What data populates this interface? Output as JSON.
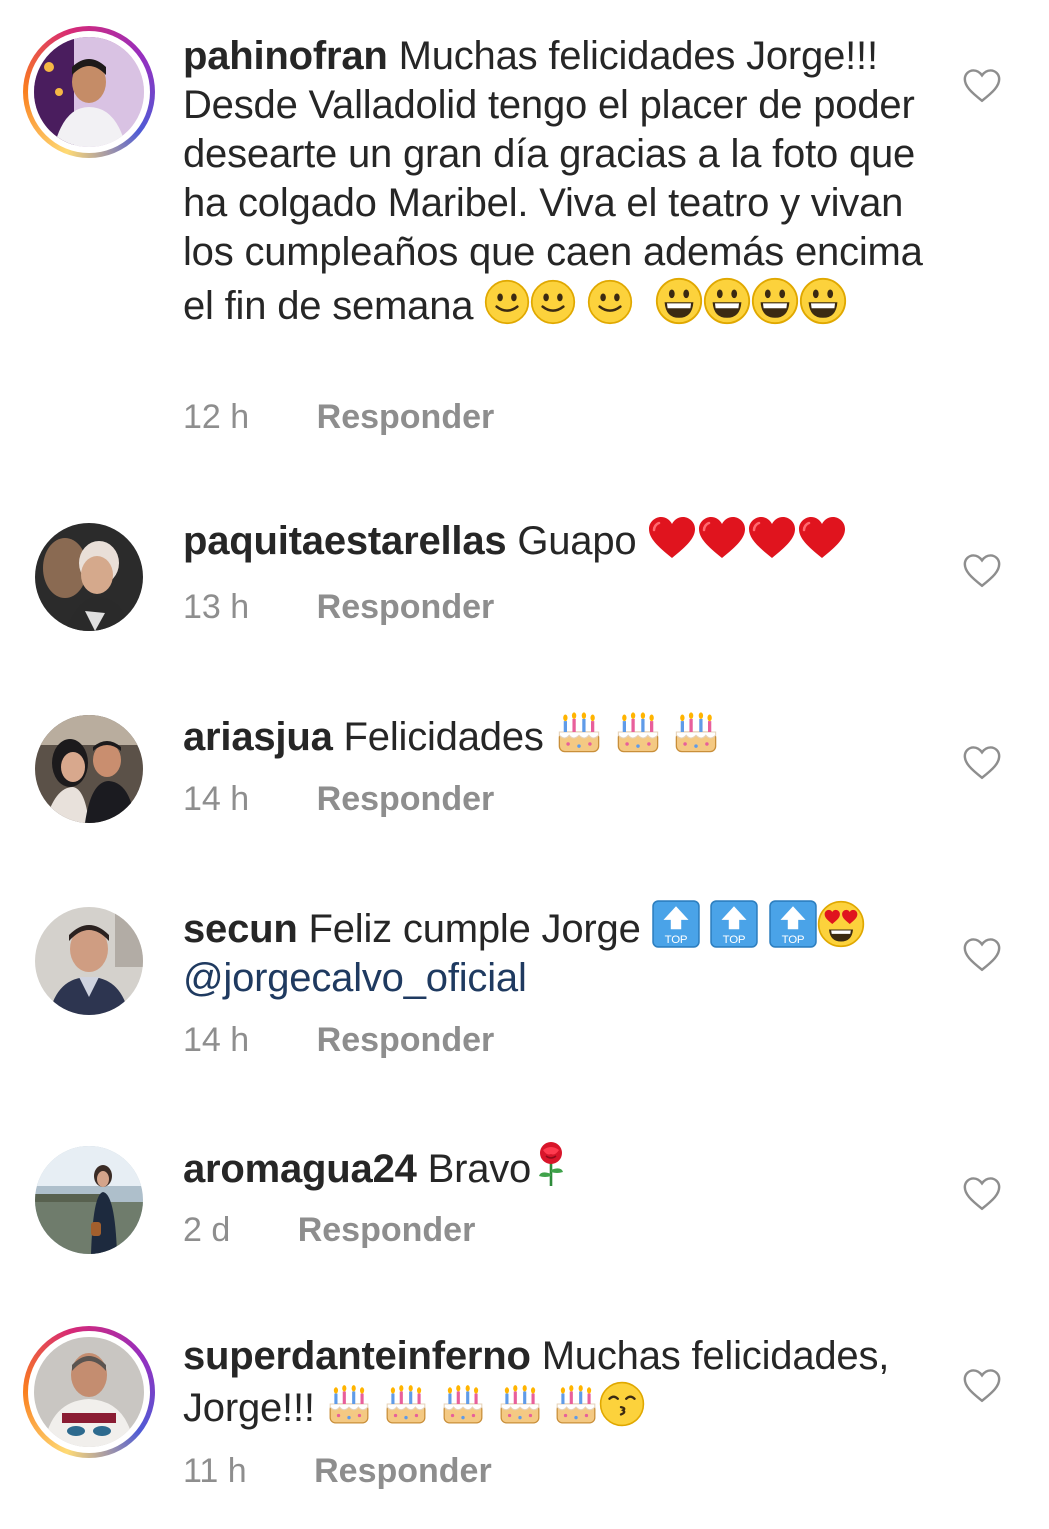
{
  "comments": [
    {
      "username": "pahinofran",
      "text": "Muchas felicidades Jorge!!! Desde Valladolid tengo el placer de poder desearte un gran día gracias a la foto que ha colgado Maribel. Viva el teatro y vivan los cumpleaños que caen además encima el fin de semana",
      "time": "12 h",
      "reply": "Responder",
      "emoji": [
        "slightly-smiling-face-icon",
        "slightly-smiling-face-icon",
        "slightly-smiling-face-icon",
        "grinning-face-icon",
        "grinning-face-icon",
        "grinning-face-icon",
        "grinning-face-icon"
      ]
    },
    {
      "username": "paquitaestarellas",
      "text": "Guapo",
      "time": "13 h",
      "reply": "Responder",
      "emoji": [
        "red-heart-icon",
        "red-heart-icon",
        "red-heart-icon",
        "red-heart-icon"
      ]
    },
    {
      "username": "ariasjua",
      "text": "Felicidades",
      "time": "14 h",
      "reply": "Responder",
      "emoji": [
        "birthday-cake-icon",
        "birthday-cake-icon",
        "birthday-cake-icon"
      ]
    },
    {
      "username": "secun",
      "text": "Feliz cumple Jorge",
      "mention": "@jorgecalvo_oficial",
      "time": "14 h",
      "reply": "Responder",
      "emoji": [
        "top-arrow-icon",
        "top-arrow-icon",
        "top-arrow-icon",
        "heart-eyes-face-icon"
      ],
      "top_label": "TOP"
    },
    {
      "username": "aromagua24",
      "text": "Bravo",
      "time": "2 d",
      "reply": "Responder",
      "emoji": [
        "rose-icon"
      ]
    },
    {
      "username": "superdanteinferno",
      "text": "Muchas felicidades, Jorge!!!",
      "time": "11 h",
      "reply": "Responder",
      "emoji": [
        "birthday-cake-icon",
        "birthday-cake-icon",
        "birthday-cake-icon",
        "birthday-cake-icon",
        "birthday-cake-icon",
        "kissing-face-icon"
      ]
    }
  ],
  "colors": {
    "text": "#262626",
    "meta": "#8e8e8e",
    "mention": "#1f3a60",
    "heart_outline": "#8e8e8e"
  }
}
